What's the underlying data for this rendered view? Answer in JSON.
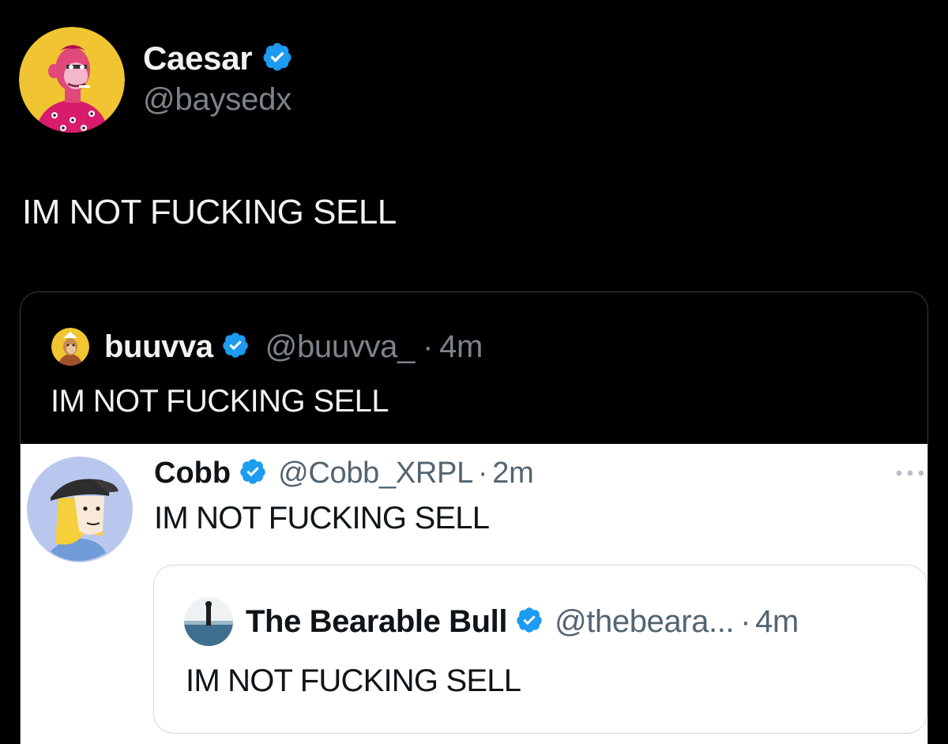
{
  "colors": {
    "background": "#000000",
    "verified_blue": "#1d9bf0",
    "dark_secondary_text": "#7c838a",
    "light_secondary_text": "#536471"
  },
  "main_tweet": {
    "display_name": "Caesar",
    "handle": "@baysedx",
    "text": "IM NOT FUCKING SELL",
    "avatar_icon": "bored-ape-avatar-icon",
    "verified": true
  },
  "quoted_tweet": {
    "display_name": "buuvva",
    "handle": "@buuvva_",
    "separator": "·",
    "time": "4m",
    "text": "IM NOT FUCKING SELL",
    "avatar_icon": "ape-avatar-icon",
    "verified": true
  },
  "screenshot_tweet": {
    "display_name": "Cobb",
    "handle": "@Cobb_XRPL",
    "separator": "·",
    "time": "2m",
    "text": "IM NOT FUCKING SELL",
    "avatar_icon": "cartoon-cap-avatar-icon",
    "more_icon": "more-options-icon",
    "verified": true
  },
  "nested_quote": {
    "display_name": "The Bearable Bull",
    "handle": "@thebeara...",
    "separator": "·",
    "time": "4m",
    "text": "IM NOT FUCKING SELL",
    "avatar_icon": "photo-avatar-icon",
    "verified": true
  }
}
